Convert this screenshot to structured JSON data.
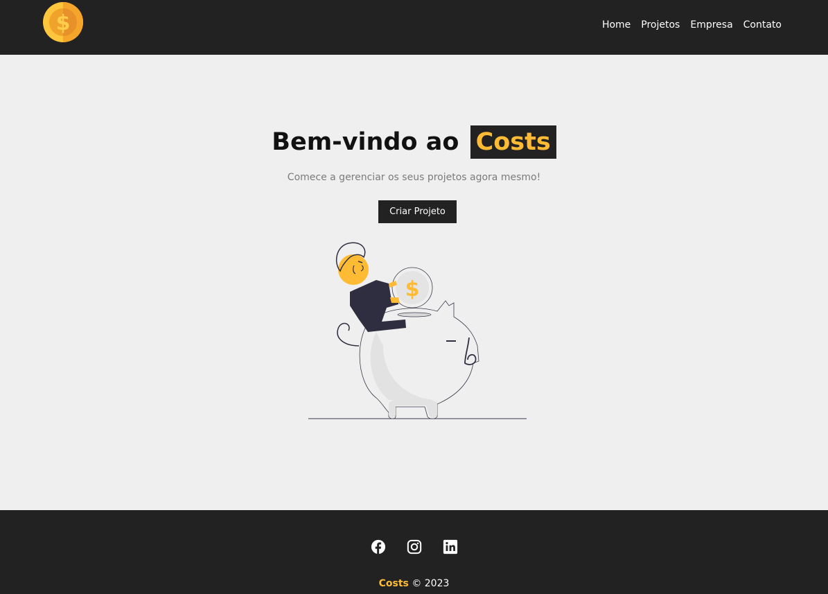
{
  "navbar": {
    "logo_icon": "dollar-coin-icon",
    "links": [
      {
        "label": "Home"
      },
      {
        "label": "Projetos"
      },
      {
        "label": "Empresa"
      },
      {
        "label": "Contato"
      }
    ]
  },
  "hero": {
    "title_prefix": "Bem-vindo ao",
    "title_brand": "Costs",
    "subtitle": "Comece a gerenciar os seus projetos agora mesmo!",
    "cta_label": "Criar Projeto",
    "illustration": "piggy-bank-savings-illustration"
  },
  "footer": {
    "social_icons": [
      "facebook-icon",
      "instagram-icon",
      "linkedin-icon"
    ],
    "brand": "Costs",
    "copyright": "© 2023"
  },
  "colors": {
    "dark": "#222222",
    "accent": "#ffbb33",
    "background": "#efefef",
    "muted_text": "#7b7b7b"
  }
}
